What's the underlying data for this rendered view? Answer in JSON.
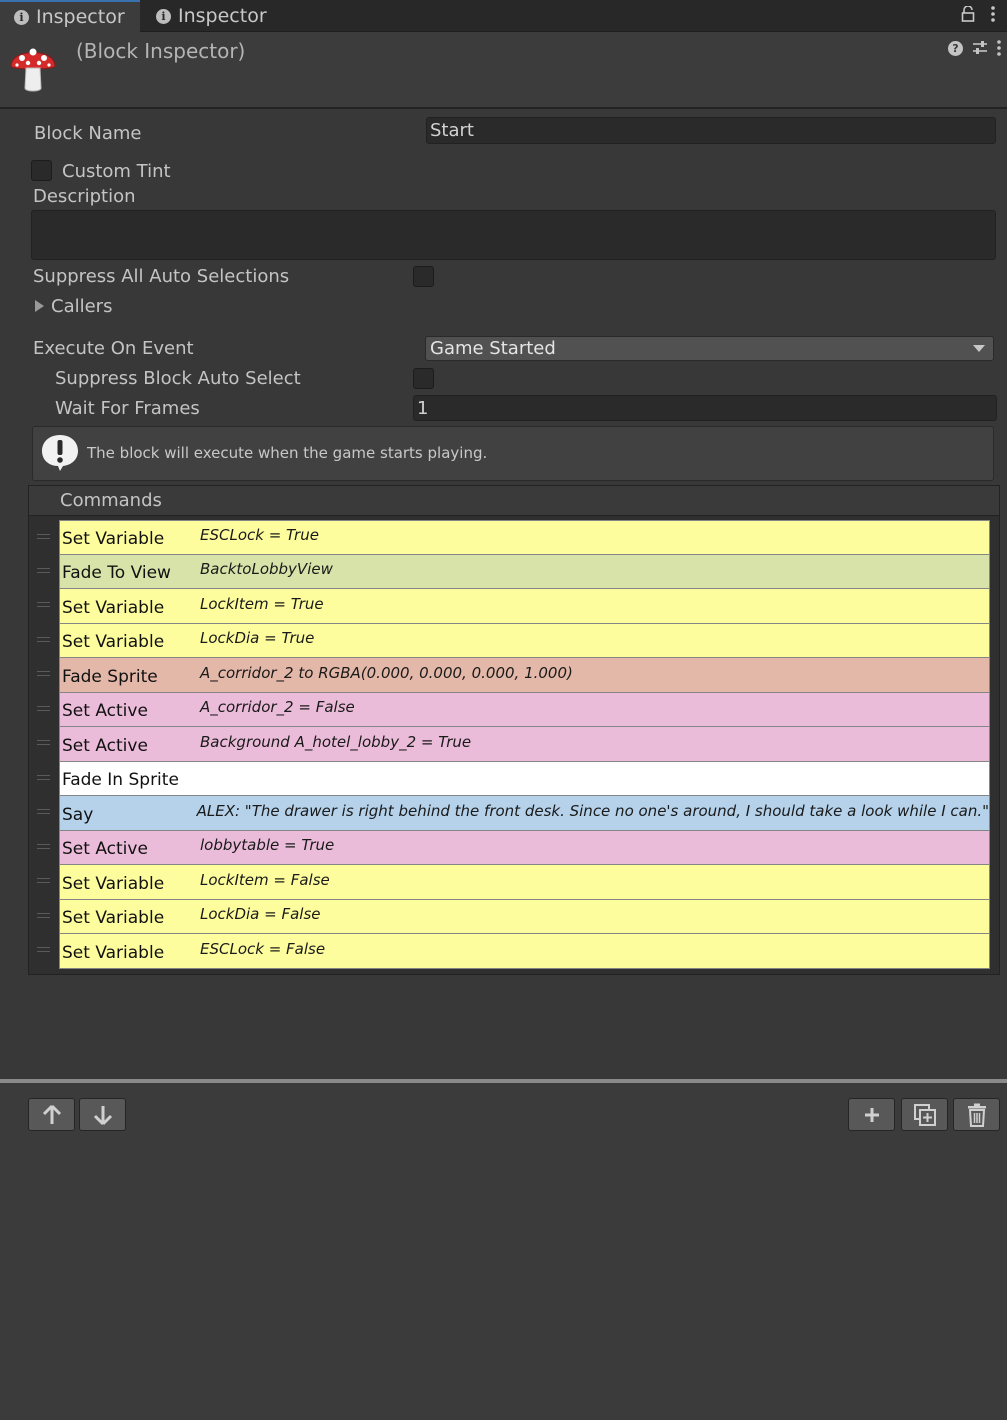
{
  "tabs": [
    {
      "label": "Inspector",
      "active": true
    },
    {
      "label": "Inspector",
      "active": false
    }
  ],
  "header": {
    "title": "(Block Inspector)",
    "icon": "mushroom-icon"
  },
  "block": {
    "name_label": "Block Name",
    "name_value": "Start",
    "custom_tint_label": "Custom Tint",
    "description_label": "Description",
    "description_value": "",
    "suppress_all_label": "Suppress All Auto Selections",
    "callers_label": "Callers",
    "execute_label": "Execute On Event",
    "execute_value": "Game Started",
    "suppress_block_label": "Suppress Block Auto Select",
    "wait_frames_label": "Wait For Frames",
    "wait_frames_value": "1",
    "help_text": "The block will execute when the game starts playing."
  },
  "commands": {
    "title": "Commands",
    "items": [
      {
        "name": "Set Variable",
        "summary": "ESCLock = True",
        "color": "#fdfd9d"
      },
      {
        "name": "Fade To View",
        "summary": "BacktoLobbyView",
        "color": "#d8e3a9"
      },
      {
        "name": "Set Variable",
        "summary": "LockItem = True",
        "color": "#fdfd9d"
      },
      {
        "name": "Set Variable",
        "summary": "LockDia = True",
        "color": "#fdfd9d"
      },
      {
        "name": "Fade Sprite",
        "summary": "A_corridor_2 to RGBA(0.000, 0.000, 0.000, 1.000)",
        "color": "#e3b8a8"
      },
      {
        "name": "Set Active",
        "summary": "A_corridor_2 = False",
        "color": "#ebbcd9"
      },
      {
        "name": "Set Active",
        "summary": "Background A_hotel_lobby_2 = True",
        "color": "#ebbcd9"
      },
      {
        "name": "Fade In Sprite",
        "summary": "",
        "color": "#ffffff"
      },
      {
        "name": "Say",
        "summary": "ALEX: \"The drawer is right behind the front desk. Since no one's around, I should take a look while I can.\"",
        "color": "#b5d2ea"
      },
      {
        "name": "Set Active",
        "summary": "lobbytable = True",
        "color": "#ebbcd9"
      },
      {
        "name": "Set Variable",
        "summary": "LockItem = False",
        "color": "#fdfd9d"
      },
      {
        "name": "Set Variable",
        "summary": "LockDia = False",
        "color": "#fdfd9d"
      },
      {
        "name": "Set Variable",
        "summary": "ESCLock = False",
        "color": "#fdfd9d"
      }
    ]
  },
  "toolbar": {
    "up_icon": "arrow-up-icon",
    "down_icon": "arrow-down-icon",
    "add_icon": "plus-icon",
    "duplicate_icon": "duplicate-icon",
    "delete_icon": "trash-icon"
  }
}
